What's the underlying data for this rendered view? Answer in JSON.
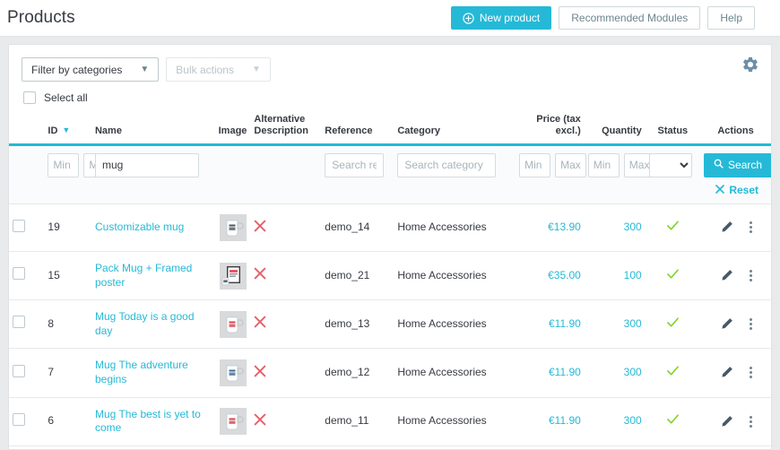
{
  "header": {
    "title": "Products",
    "new_product_label": "New product",
    "recommended_modules_label": "Recommended Modules",
    "help_label": "Help"
  },
  "toolbar": {
    "filter_by_categories_label": "Filter by categories",
    "bulk_actions_label": "Bulk actions",
    "select_all_label": "Select all",
    "gear_title": "Settings"
  },
  "table": {
    "columns": {
      "id": "ID",
      "name": "Name",
      "image": "Image",
      "alternative_description": "Alternative Description",
      "reference": "Reference",
      "category": "Category",
      "price": "Price (tax excl.)",
      "quantity": "Quantity",
      "status": "Status",
      "actions": "Actions"
    },
    "filters": {
      "id_min_placeholder": "Min",
      "id_max_placeholder": "Max",
      "name_value": "mug",
      "name_placeholder": "",
      "reference_placeholder": "Search ref.",
      "category_placeholder": "Search category",
      "price_min_placeholder": "Min",
      "price_max_placeholder": "Max",
      "quantity_min_placeholder": "Min",
      "quantity_max_placeholder": "Max",
      "status_selected": "",
      "search_label": "Search",
      "reset_label": "Reset"
    },
    "rows": [
      {
        "id": "19",
        "name": "Customizable mug",
        "alt_description": "no",
        "reference": "demo_14",
        "category": "Home Accessories",
        "price": "€13.90",
        "quantity": "300",
        "status": "enabled",
        "thumb": "mug-white"
      },
      {
        "id": "15",
        "name": "Pack Mug + Framed poster",
        "alt_description": "no",
        "reference": "demo_21",
        "category": "Home Accessories",
        "price": "€35.00",
        "quantity": "100",
        "status": "enabled",
        "thumb": "framed-poster"
      },
      {
        "id": "8",
        "name": "Mug Today is a good day",
        "alt_description": "no",
        "reference": "demo_13",
        "category": "Home Accessories",
        "price": "€11.90",
        "quantity": "300",
        "status": "enabled",
        "thumb": "mug-today"
      },
      {
        "id": "7",
        "name": "Mug The adventure begins",
        "alt_description": "no",
        "reference": "demo_12",
        "category": "Home Accessories",
        "price": "€11.90",
        "quantity": "300",
        "status": "enabled",
        "thumb": "mug-adventure"
      },
      {
        "id": "6",
        "name": "Mug The best is yet to come",
        "alt_description": "no",
        "reference": "demo_11",
        "category": "Home Accessories",
        "price": "€11.90",
        "quantity": "300",
        "status": "enabled",
        "thumb": "mug-best"
      }
    ]
  },
  "colors": {
    "accent": "#25b9d7",
    "status_ok": "#7ed321",
    "status_no": "#e4606a",
    "text": "#363a41",
    "page_bg": "#e8eaec"
  }
}
